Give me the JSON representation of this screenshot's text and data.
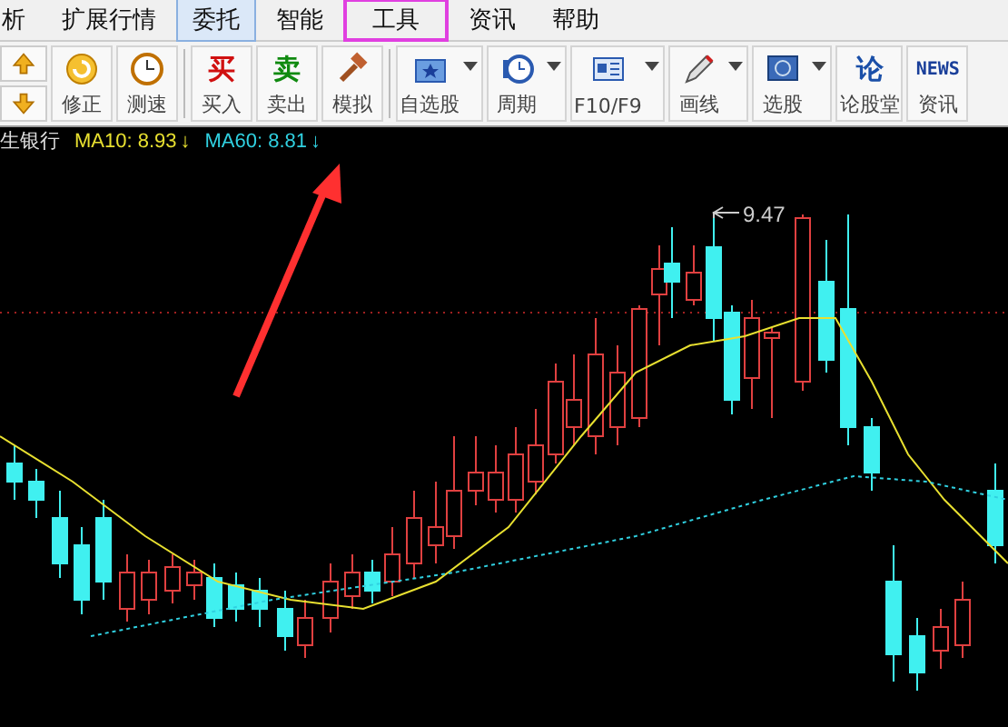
{
  "menu": [
    {
      "label": "析",
      "selected": false,
      "highlighted": false
    },
    {
      "label": "扩展行情",
      "selected": false,
      "highlighted": false
    },
    {
      "label": "委托",
      "selected": true,
      "highlighted": false
    },
    {
      "label": "智能",
      "selected": false,
      "highlighted": false
    },
    {
      "label": "工具",
      "selected": false,
      "highlighted": true
    },
    {
      "label": "资讯",
      "selected": false,
      "highlighted": false
    },
    {
      "label": "帮助",
      "selected": false,
      "highlighted": false
    }
  ],
  "toolbar": [
    {
      "kind": "plain",
      "label": "修正"
    },
    {
      "kind": "plain",
      "label": "测速"
    },
    {
      "kind": "trade",
      "label": "买入",
      "glyph": "买",
      "color": "#d01010"
    },
    {
      "kind": "trade",
      "label": "卖出",
      "glyph": "卖",
      "color": "#108a10"
    },
    {
      "kind": "plain",
      "label": "模拟"
    },
    {
      "kind": "dropdown",
      "label": "自选股"
    },
    {
      "kind": "dropdown",
      "label": "周期"
    },
    {
      "kind": "dropdown",
      "label": "F10/F9"
    },
    {
      "kind": "dropdown",
      "label": "画线"
    },
    {
      "kind": "dropdown",
      "label": "选股"
    },
    {
      "kind": "plain",
      "label": "论股堂",
      "glyph": "论",
      "color": "#1a4fa8"
    },
    {
      "kind": "plain",
      "label": "资讯",
      "glyph": "NEWS",
      "color": "#1a3f9a"
    }
  ],
  "info": {
    "stock": "生银行",
    "indicators": [
      {
        "label": "MA10: 8.93",
        "arrow": "↓",
        "color": "#e8e030"
      },
      {
        "label": "MA60: 8.81",
        "arrow": "↓",
        "color": "#30d0e0"
      }
    ]
  },
  "chart": {
    "high_label": "9.47"
  }
}
